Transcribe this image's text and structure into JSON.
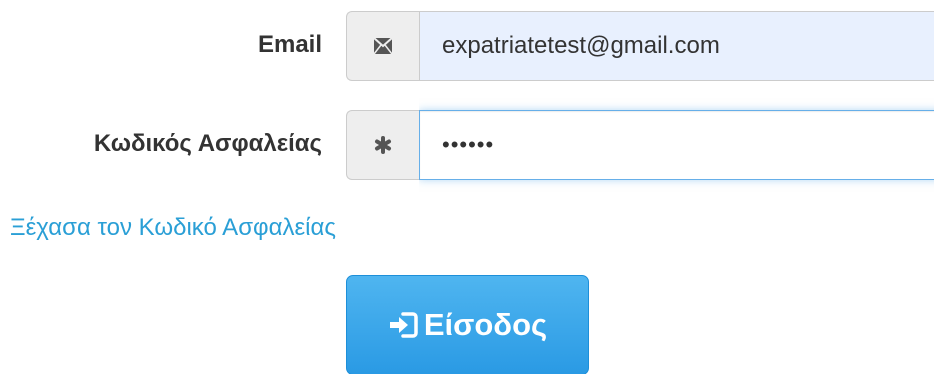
{
  "form": {
    "email_label": "Email",
    "email_icon": "envelope-icon",
    "email_value": "expatriatetest@gmail.com",
    "password_label": "Κωδικός Ασφαλείας",
    "password_icon": "asterisk-icon",
    "password_value": "••••••",
    "forgot_link": "Ξέχασα τον Κωδικό Ασφαλείας",
    "login_icon": "log-in-icon",
    "login_label": "Είσοδος"
  },
  "colors": {
    "accent": "#2a9fd6",
    "button": "#2a9ae4",
    "autofill_bg": "#e8f0fe",
    "focus_border": "#66afe9"
  }
}
